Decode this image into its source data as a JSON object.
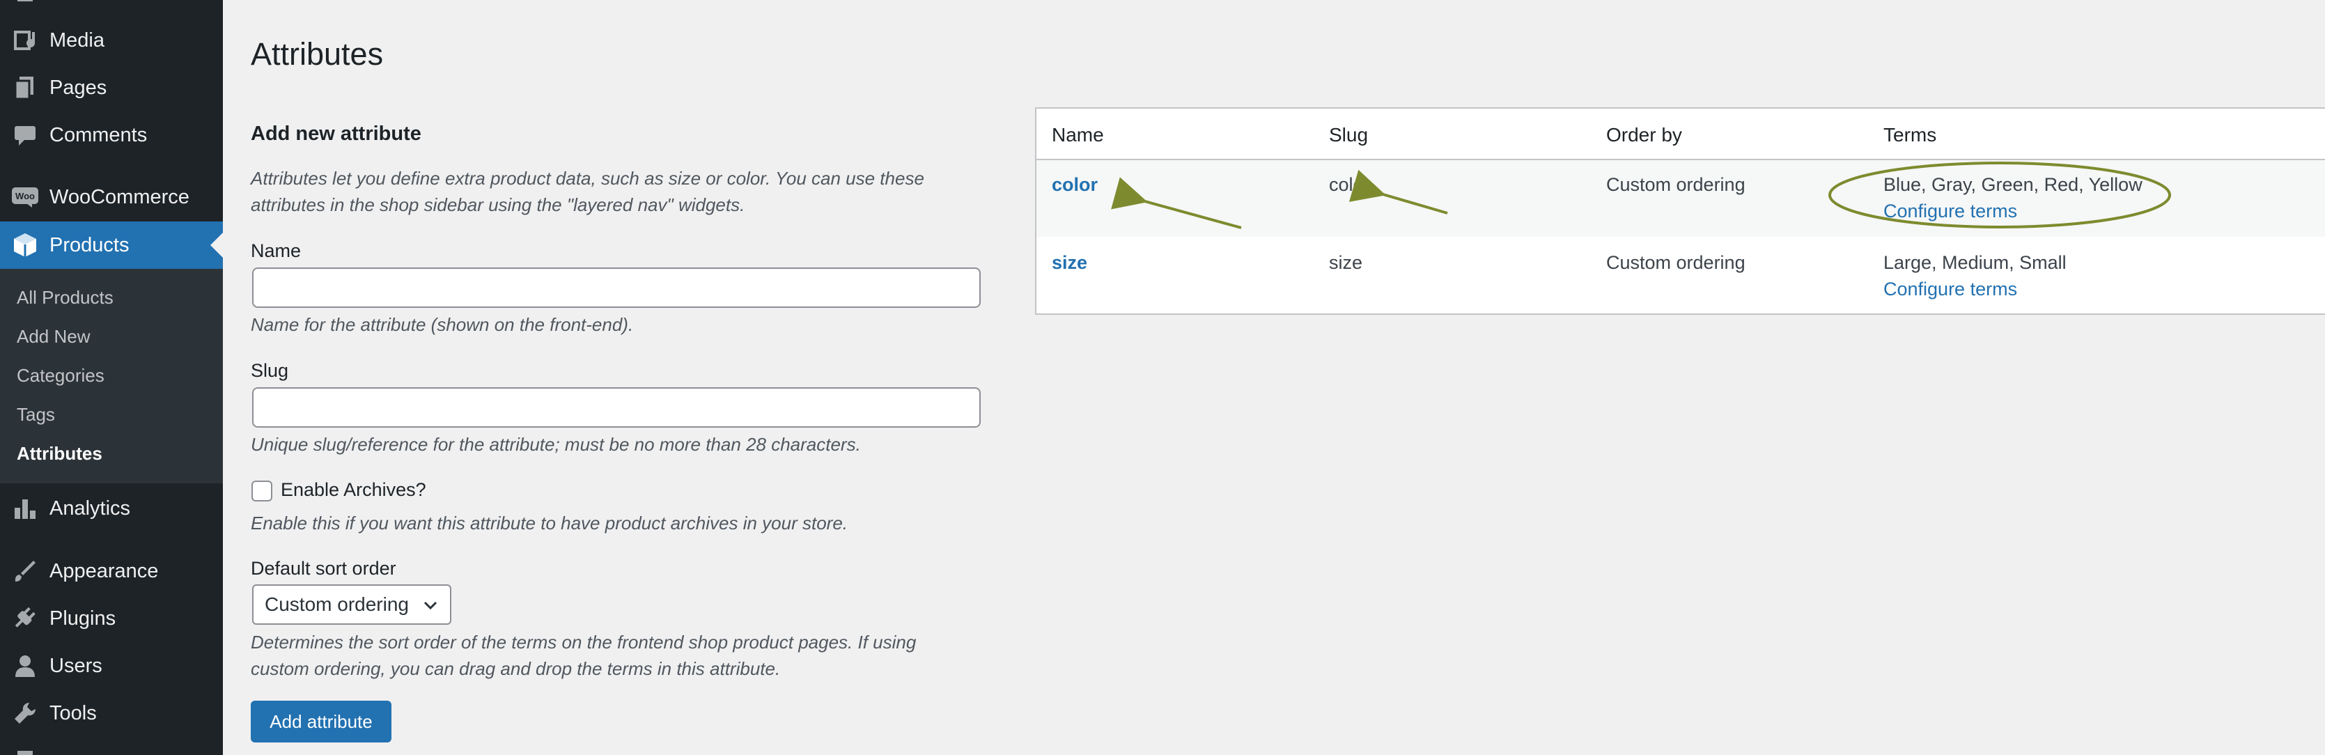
{
  "sidebar": {
    "items": [
      {
        "label": "Media",
        "icon": "media-icon"
      },
      {
        "label": "Pages",
        "icon": "pages-icon"
      },
      {
        "label": "Comments",
        "icon": "comments-icon"
      },
      {
        "label": "WooCommerce",
        "icon": "woocommerce-icon"
      },
      {
        "label": "Products",
        "icon": "products-icon",
        "active": true
      },
      {
        "label": "Analytics",
        "icon": "analytics-icon"
      },
      {
        "label": "Appearance",
        "icon": "appearance-icon"
      },
      {
        "label": "Plugins",
        "icon": "plugins-icon"
      },
      {
        "label": "Users",
        "icon": "users-icon"
      },
      {
        "label": "Tools",
        "icon": "tools-icon"
      }
    ],
    "woo_badge": "Woo",
    "submenu": [
      "All Products",
      "Add New",
      "Categories",
      "Tags",
      "Attributes"
    ],
    "current_submenu": "Attributes"
  },
  "page": {
    "title": "Attributes"
  },
  "form": {
    "title": "Add new attribute",
    "intro_line1": "Attributes let you define extra product data, such as size or color. You can use these",
    "intro_line2": "attributes in the shop sidebar using the \"layered nav\" widgets.",
    "name_label": "Name",
    "name_value": "",
    "name_help": "Name for the attribute (shown on the front-end).",
    "slug_label": "Slug",
    "slug_value": "",
    "slug_help": "Unique slug/reference for the attribute; must be no more than 28 characters.",
    "archives_label": "Enable Archives?",
    "archives_checked": false,
    "archives_help": "Enable this if you want this attribute to have product archives in your store.",
    "sort_label": "Default sort order",
    "sort_value": "Custom ordering",
    "sort_help_line1": "Determines the sort order of the terms on the frontend shop product pages. If using",
    "sort_help_line2": "custom ordering, you can drag and drop the terms in this attribute.",
    "submit_label": "Add attribute"
  },
  "table": {
    "headers": [
      "Name",
      "Slug",
      "Order by",
      "Terms"
    ],
    "rows": [
      {
        "name": "color",
        "slug": "color",
        "order_by": "Custom ordering",
        "terms": "Blue, Gray, Green, Red, Yellow",
        "configure": "Configure terms"
      },
      {
        "name": "size",
        "slug": "size",
        "order_by": "Custom ordering",
        "terms": "Large, Medium, Small",
        "configure": "Configure terms"
      }
    ]
  },
  "colors": {
    "sidebar_bg": "#1d2327",
    "submenu_bg": "#2c3338",
    "accent": "#2271b1",
    "annotation": "#7d8b2e"
  }
}
